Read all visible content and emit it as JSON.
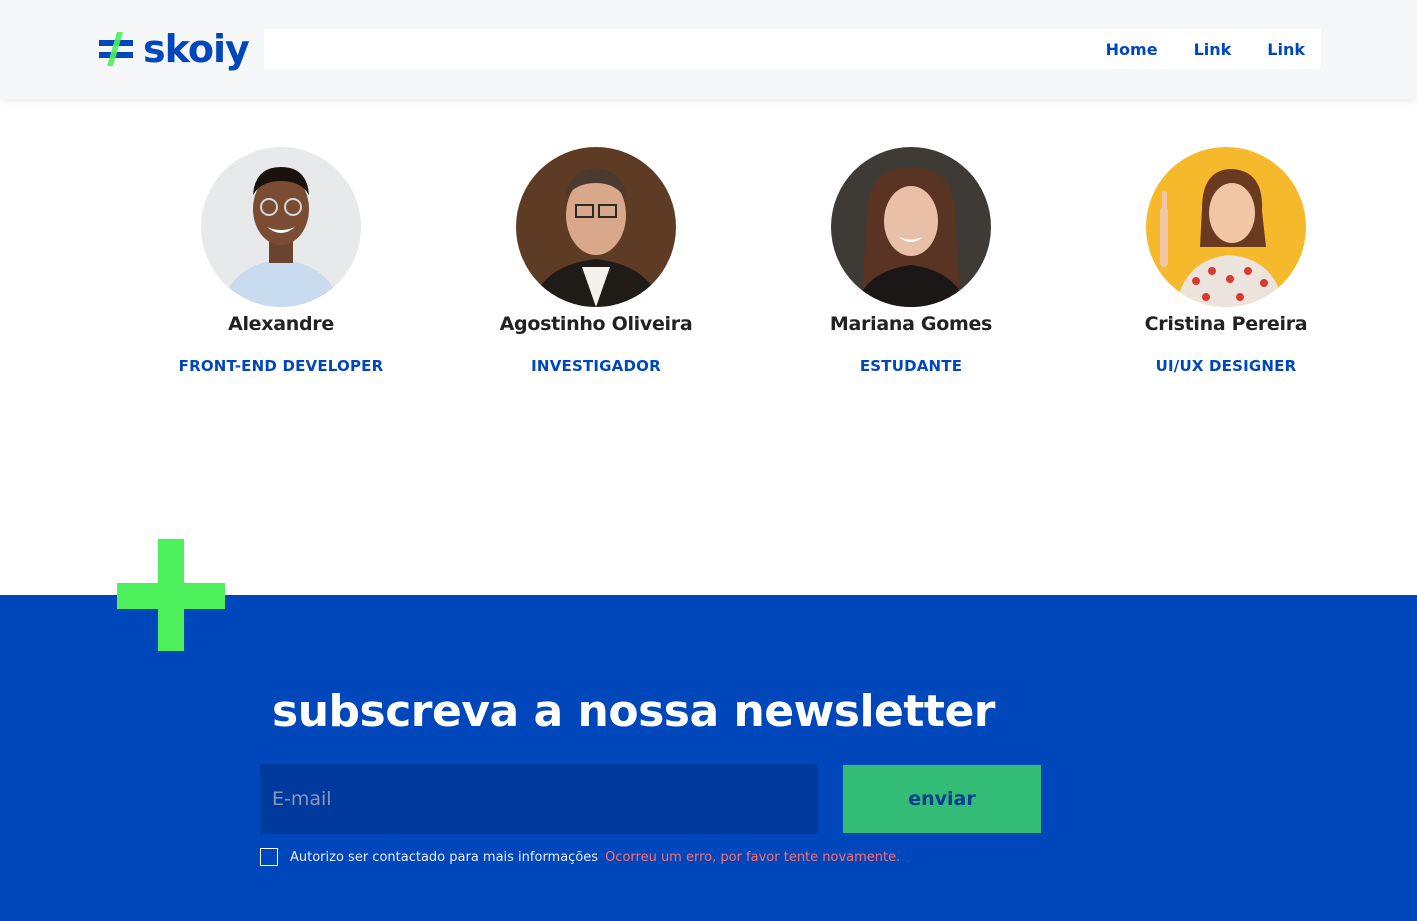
{
  "header": {
    "logo_text": "skoiy",
    "nav": [
      {
        "label": "Home"
      },
      {
        "label": "Link"
      },
      {
        "label": "Link"
      }
    ]
  },
  "team": [
    {
      "name": "Alexandre",
      "role": "FRONT-END DEVELOPER"
    },
    {
      "name": "Agostinho Oliveira",
      "role": "INVESTIGADOR"
    },
    {
      "name": "Mariana Gomes",
      "role": "ESTUDANTE"
    },
    {
      "name": "Cristina Pereira",
      "role": "UI/UX DESIGNER"
    }
  ],
  "newsletter": {
    "title": "subscreva a nossa newsletter",
    "email_placeholder": "E-mail",
    "email_value": "",
    "submit_label": "enviar",
    "consent_label": "Autorizo ser contactado para mais informações",
    "consent_checked": false,
    "error_message": "Ocorreu um erro, por favor tente novamente."
  },
  "colors": {
    "brand_blue": "#0047bb",
    "accent_green": "#4cf05a",
    "button_green": "#33bc76",
    "error_red": "#ff6e6e"
  }
}
